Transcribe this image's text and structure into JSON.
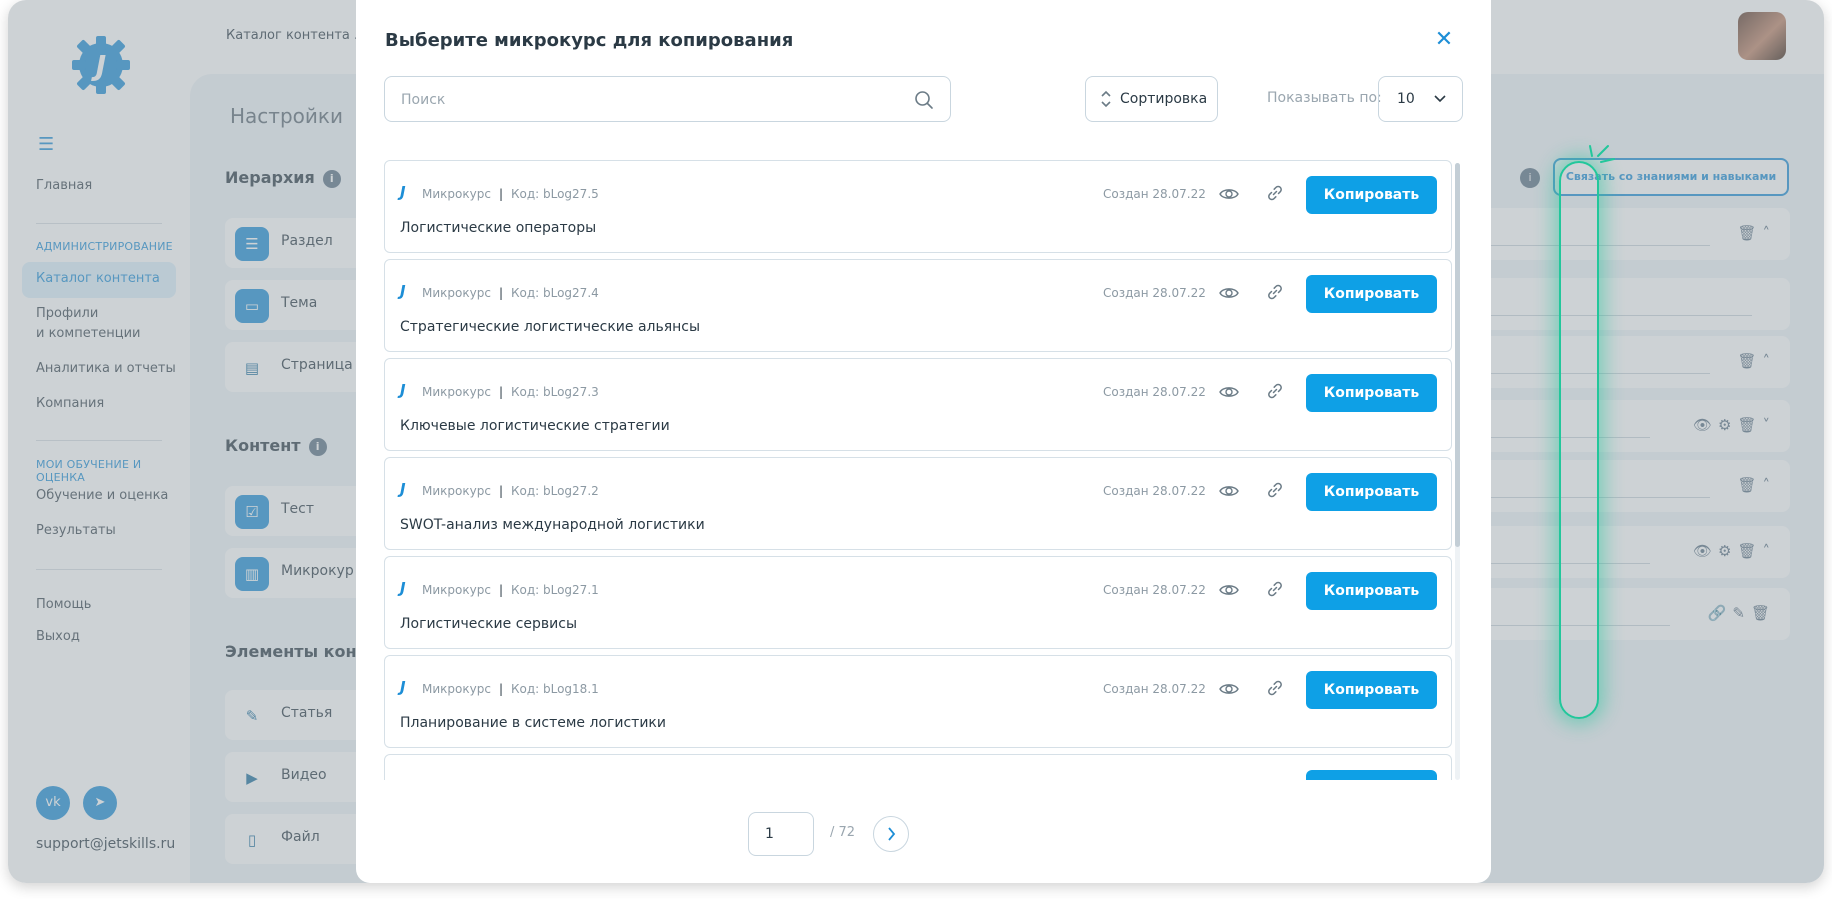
{
  "sidebar": {
    "menu_icon": "hamburger-icon",
    "items": {
      "home": "Главная",
      "admin_section": "АДМИНИСТРИРОВАНИЕ",
      "catalog": "Каталог контента",
      "profiles_1": "Профили",
      "profiles_2": "и компетенции",
      "analytics": "Аналитика и отчеты",
      "company": "Компания",
      "learning_section": "МОИ ОБУЧЕНИЕ И ОЦЕНКА",
      "learning": "Обучение и оценка",
      "results": "Результаты",
      "help": "Помощь",
      "logout": "Выход"
    },
    "social": {
      "vk": "vk",
      "telegram": "telegram"
    },
    "support_email": "support@jetskills.ru"
  },
  "header": {
    "breadcrumb": "Каталог контента ."
  },
  "settings": {
    "title": "Настройки",
    "hierarchy": "Иерархия",
    "content": "Контент",
    "elements": "Элементы конте",
    "cards": {
      "section": "Раздел",
      "topic": "Тема",
      "page": "Страница",
      "test": "Тест",
      "microcourse": "Микрокур",
      "article": "Статья",
      "video": "Видео",
      "file": "Файл"
    },
    "link_button": "Связать со знаниями и навыками"
  },
  "modal": {
    "title": "Выберите микрокурс для копирования",
    "search_placeholder": "Поиск",
    "sort_label": "Сортировка",
    "show_label": "Показывать по:",
    "per_page": "10",
    "copy_label": "Копировать",
    "items": [
      {
        "type": "Микрокурс",
        "code": "Код: bLog27.5",
        "created": "Создан 28.07.22",
        "title": "Логистические операторы"
      },
      {
        "type": "Микрокурс",
        "code": "Код: bLog27.4",
        "created": "Создан 28.07.22",
        "title": "Стратегические логистические альянсы"
      },
      {
        "type": "Микрокурс",
        "code": "Код: bLog27.3",
        "created": "Создан 28.07.22",
        "title": "Ключевые логистические стратегии"
      },
      {
        "type": "Микрокурс",
        "code": "Код: bLog27.2",
        "created": "Создан 28.07.22",
        "title": "SWOT-анализ международной логистики"
      },
      {
        "type": "Микрокурс",
        "code": "Код: bLog27.1",
        "created": "Создан 28.07.22",
        "title": "Логистические сервисы"
      },
      {
        "type": "Микрокурс",
        "code": "Код: bLog18.1",
        "created": "Создан 28.07.22",
        "title": "Планирование в системе логистики"
      }
    ],
    "pagination": {
      "current": "1",
      "total": "/ 72"
    }
  },
  "colors": {
    "accent": "#0ea0e6",
    "highlight": "#22c79b",
    "text": "#2b3a45"
  }
}
